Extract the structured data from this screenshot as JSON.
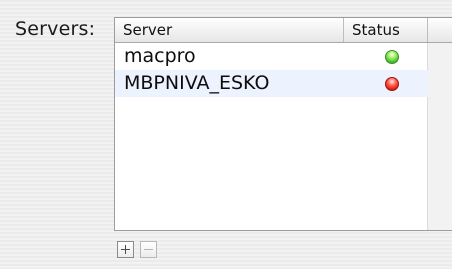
{
  "label": "Servers:",
  "table": {
    "columns": [
      "Server",
      "Status"
    ],
    "rows": [
      {
        "server": "macpro",
        "status": "online",
        "status_color": "#3fb92b"
      },
      {
        "server": "MBPNIVA_ESKO",
        "status": "offline",
        "status_color": "#e31b12"
      }
    ]
  },
  "buttons": {
    "add_icon": "plus-icon",
    "remove_icon": "minus-icon"
  }
}
